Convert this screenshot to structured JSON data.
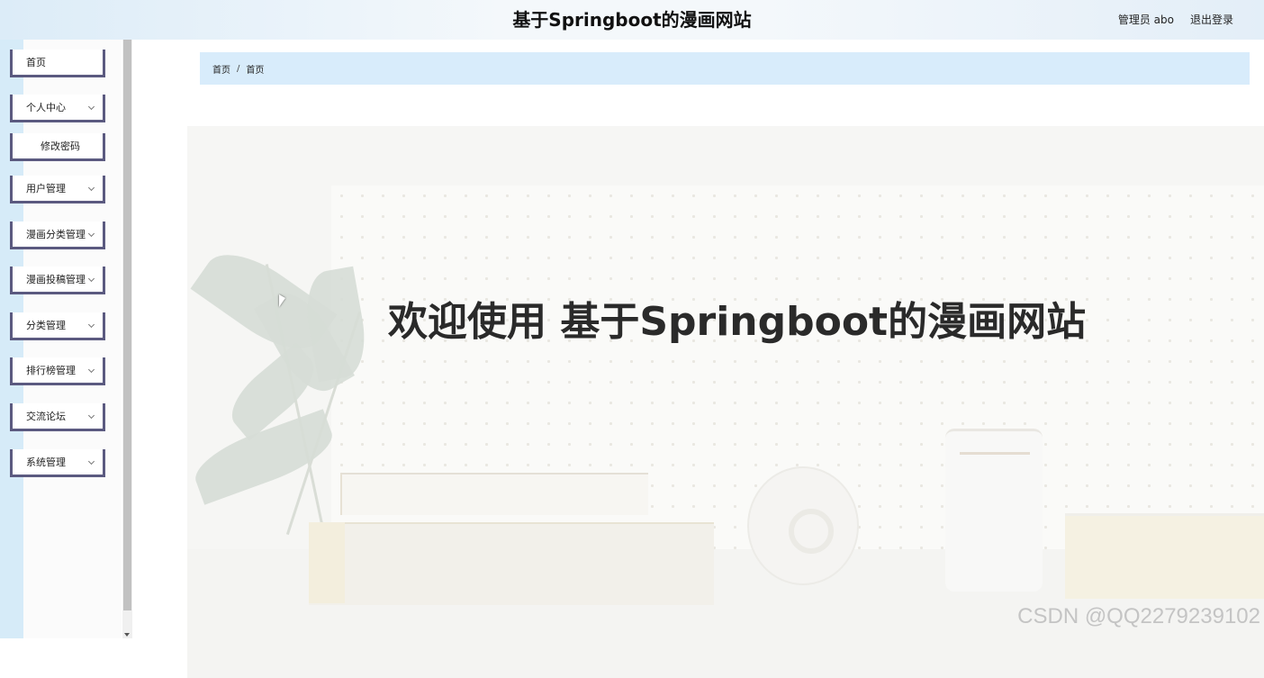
{
  "header": {
    "title": "基于Springboot的漫画网站",
    "user_label": "管理员 abo",
    "logout_label": "退出登录"
  },
  "sidebar": {
    "items": [
      {
        "label": "首页",
        "has_chevron": false
      },
      {
        "label": "个人中心",
        "has_chevron": true
      },
      {
        "label": "修改密码",
        "has_chevron": false
      },
      {
        "label": "用户管理",
        "has_chevron": true
      },
      {
        "label": "漫画分类管理",
        "has_chevron": true
      },
      {
        "label": "漫画投稿管理",
        "has_chevron": true
      },
      {
        "label": "分类管理",
        "has_chevron": true
      },
      {
        "label": "排行榜管理",
        "has_chevron": true
      },
      {
        "label": "交流论坛",
        "has_chevron": true
      },
      {
        "label": "系统管理",
        "has_chevron": true
      }
    ]
  },
  "breadcrumb": {
    "items": [
      "首页",
      "首页"
    ],
    "separator": "/"
  },
  "main": {
    "welcome_text": "欢迎使用 基于Springboot的漫画网站"
  },
  "watermark": {
    "text": "CSDN @QQ2279239102"
  },
  "colors": {
    "topbar": "#f4f8fb",
    "sidebar_accent": "#5b5a80",
    "breadcrumb_bg": "#d8ecfb",
    "sidebar_strip": "#d6ebf8"
  },
  "icons": [
    "chevron-down-icon",
    "mouse-cursor-icon"
  ]
}
